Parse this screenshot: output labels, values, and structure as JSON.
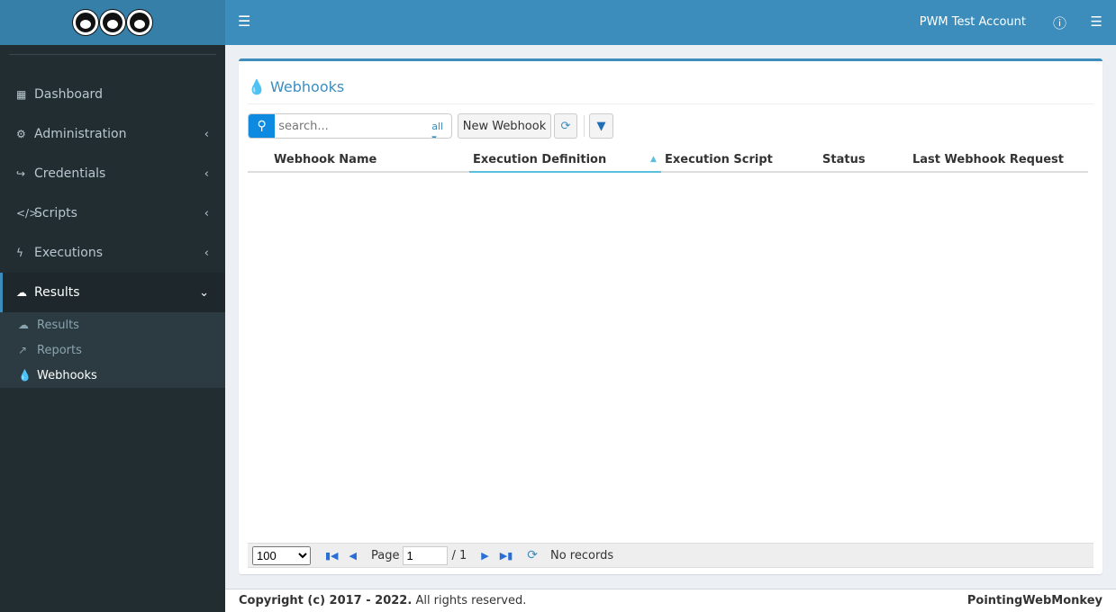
{
  "header": {
    "account": "PWM Test Account"
  },
  "sidebar": {
    "items": [
      {
        "label": "Dashboard"
      },
      {
        "label": "Administration"
      },
      {
        "label": "Credentials"
      },
      {
        "label": "Scripts"
      },
      {
        "label": "Executions"
      },
      {
        "label": "Results"
      }
    ],
    "sub": [
      {
        "label": "Results"
      },
      {
        "label": "Reports"
      },
      {
        "label": "Webhooks"
      }
    ]
  },
  "main": {
    "title": "Webhooks",
    "search_placeholder": "search...",
    "search_scope": "all",
    "new_button": "New Webhook",
    "columns": [
      "Webhook Name",
      "Execution Definition",
      "Execution Script",
      "Status",
      "Last Webhook Request"
    ],
    "pager": {
      "page_size": "100",
      "page_label": "Page",
      "page": "1",
      "total": "/ 1",
      "status": "No records"
    }
  },
  "footer": {
    "copyright": "Copyright (c) 2017 - 2022.",
    "rights": "All rights reserved.",
    "brand": "PointingWebMonkey"
  },
  "colors": {
    "accent": "#3c8dbc",
    "sidebar": "#222d32"
  }
}
